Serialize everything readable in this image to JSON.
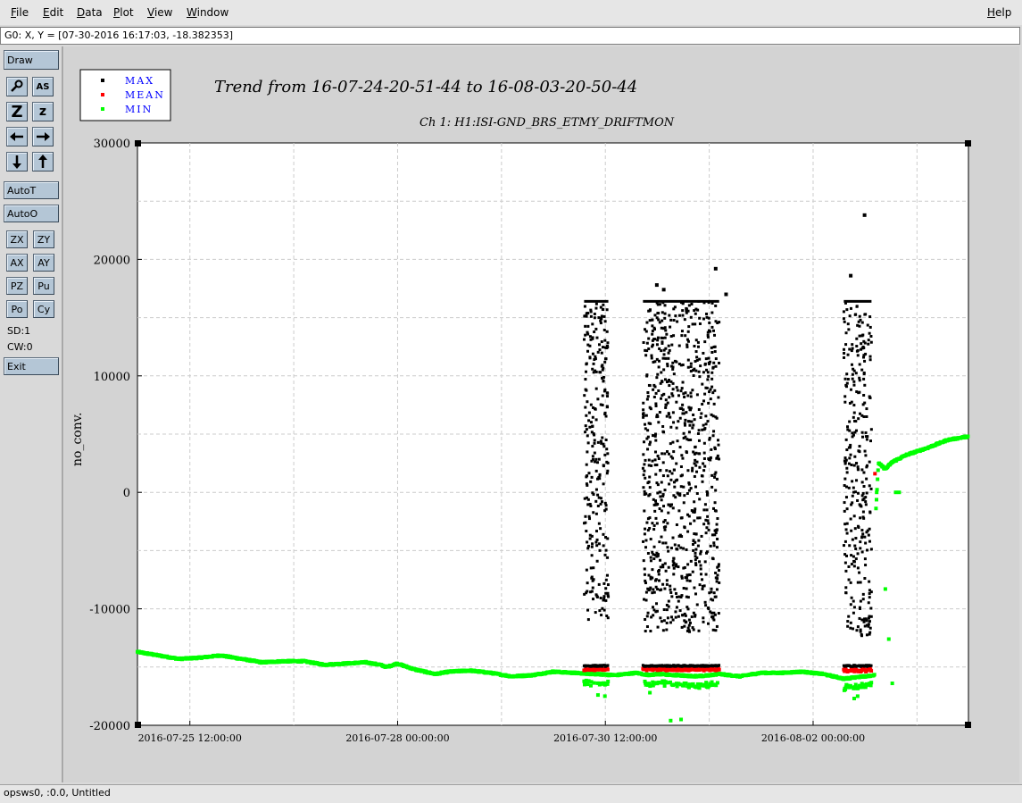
{
  "menu": {
    "file": {
      "u": "F",
      "rest": "ile"
    },
    "edit": {
      "u": "E",
      "rest": "dit"
    },
    "data": {
      "u": "D",
      "rest": "ata"
    },
    "plot": {
      "u": "P",
      "rest": "lot"
    },
    "view": {
      "u": "V",
      "rest": "iew"
    },
    "window": {
      "u": "W",
      "rest": "indow"
    },
    "help": {
      "u": "H",
      "rest": "elp"
    }
  },
  "coord_readout": "G0: X, Y = [07-30-2016 16:17:03, -18.382353]",
  "toolbar": {
    "draw": "Draw",
    "magnify_icon": "magnifier-icon",
    "as_label": "AS",
    "zoom_big": "Z",
    "zoom_small": "z",
    "autot": "AutoT",
    "autoo": "AutoO",
    "zx": "ZX",
    "zy": "ZY",
    "ax": "AX",
    "ay": "AY",
    "pz": "PZ",
    "pu": "Pu",
    "po": "Po",
    "cy": "Cy",
    "sd": "SD:1",
    "cw": "CW:0",
    "exit": "Exit"
  },
  "status": "opsws0, :0.0, Untitled",
  "colors": {
    "max": "#000000",
    "mean": "#ff0000",
    "min": "#00ff00",
    "legend_text": "#0000ff",
    "button": "#b4c6d6"
  },
  "chart_data": {
    "type": "scatter",
    "title": "Trend from 16-07-24-20-51-44 to 16-08-03-20-50-44",
    "subtitle": "Ch 1: H1:ISI-GND_BRS_ETMY_DRIFTMON",
    "xlabel": "",
    "ylabel": "no_conv.",
    "xlim_hours_from_start": [
      0,
      240
    ],
    "ylim": [
      -20000,
      30000
    ],
    "yticks": [
      -20000,
      -10000,
      0,
      10000,
      20000,
      30000
    ],
    "xticks": [
      {
        "label": "2016-07-25 12:00:00",
        "hours": 15.14
      },
      {
        "label": "2016-07-28 00:00:00",
        "hours": 75.14
      },
      {
        "label": "2016-07-30 12:00:00",
        "hours": 135.14
      },
      {
        "label": "2016-08-02 00:00:00",
        "hours": 195.14
      }
    ],
    "legend": {
      "position": "top-left",
      "entries": [
        "MAX",
        "MEAN",
        "MIN"
      ]
    },
    "grid": true,
    "series": [
      {
        "name": "MIN",
        "trend": [
          [
            0,
            -13700
          ],
          [
            6,
            -14000
          ],
          [
            12,
            -14300
          ],
          [
            18,
            -14200
          ],
          [
            24,
            -14000
          ],
          [
            30,
            -14300
          ],
          [
            36,
            -14600
          ],
          [
            42,
            -14500
          ],
          [
            48,
            -14500
          ],
          [
            54,
            -14800
          ],
          [
            60,
            -14700
          ],
          [
            66,
            -14600
          ],
          [
            70,
            -14800
          ],
          [
            72,
            -15000
          ],
          [
            75,
            -14700
          ],
          [
            80,
            -15200
          ],
          [
            86,
            -15600
          ],
          [
            90,
            -15400
          ],
          [
            96,
            -15300
          ],
          [
            102,
            -15500
          ],
          [
            108,
            -15800
          ],
          [
            114,
            -15700
          ],
          [
            120,
            -15400
          ],
          [
            126,
            -15500
          ],
          [
            132,
            -15600
          ],
          [
            138,
            -15700
          ],
          [
            144,
            -15500
          ],
          [
            148,
            -15700
          ],
          [
            150,
            -15600
          ],
          [
            156,
            -15700
          ],
          [
            162,
            -15800
          ],
          [
            168,
            -15600
          ],
          [
            174,
            -15800
          ],
          [
            180,
            -15500
          ],
          [
            186,
            -15500
          ],
          [
            192,
            -15400
          ],
          [
            198,
            -15600
          ],
          [
            204,
            -16000
          ],
          [
            210,
            -15800
          ],
          [
            213,
            -15700
          ],
          [
            213.2,
            -2000
          ],
          [
            214,
            2500
          ],
          [
            216,
            2000
          ],
          [
            218,
            2600
          ],
          [
            222,
            3200
          ],
          [
            228,
            3800
          ],
          [
            234,
            4500
          ],
          [
            240,
            4800
          ]
        ],
        "outliers": [
          [
            133,
            -17400
          ],
          [
            135,
            -17500
          ],
          [
            148,
            -17200
          ],
          [
            154,
            -19600
          ],
          [
            157,
            -19500
          ],
          [
            161,
            -16700
          ],
          [
            207,
            -17700
          ],
          [
            208,
            -17500
          ],
          [
            213.5,
            0
          ],
          [
            216,
            -8300
          ],
          [
            217,
            -12600
          ],
          [
            218,
            -16400
          ],
          [
            219,
            0
          ],
          [
            220,
            0
          ]
        ]
      },
      {
        "name": "MEAN",
        "blocks": [
          [
            129,
            136,
            -15100,
            -15300
          ],
          [
            146,
            168,
            -15100,
            -15300
          ],
          [
            204,
            212,
            -15100,
            -15400
          ]
        ],
        "outliers": [
          [
            213,
            1600
          ]
        ]
      },
      {
        "name": "MAX",
        "blocks": [
          [
            129,
            136,
            -11000,
            16300
          ],
          [
            146,
            168,
            -12000,
            16400
          ],
          [
            204,
            212,
            -12500,
            16300
          ]
        ],
        "flat": [
          [
            129,
            136,
            16400
          ],
          [
            146,
            168,
            16400
          ],
          [
            204,
            212,
            16400
          ]
        ],
        "low_band": -14900,
        "outliers": [
          [
            150,
            17800
          ],
          [
            152,
            17400
          ],
          [
            167,
            19200
          ],
          [
            170,
            17000
          ],
          [
            206,
            18600
          ],
          [
            210,
            23800
          ]
        ]
      }
    ]
  }
}
